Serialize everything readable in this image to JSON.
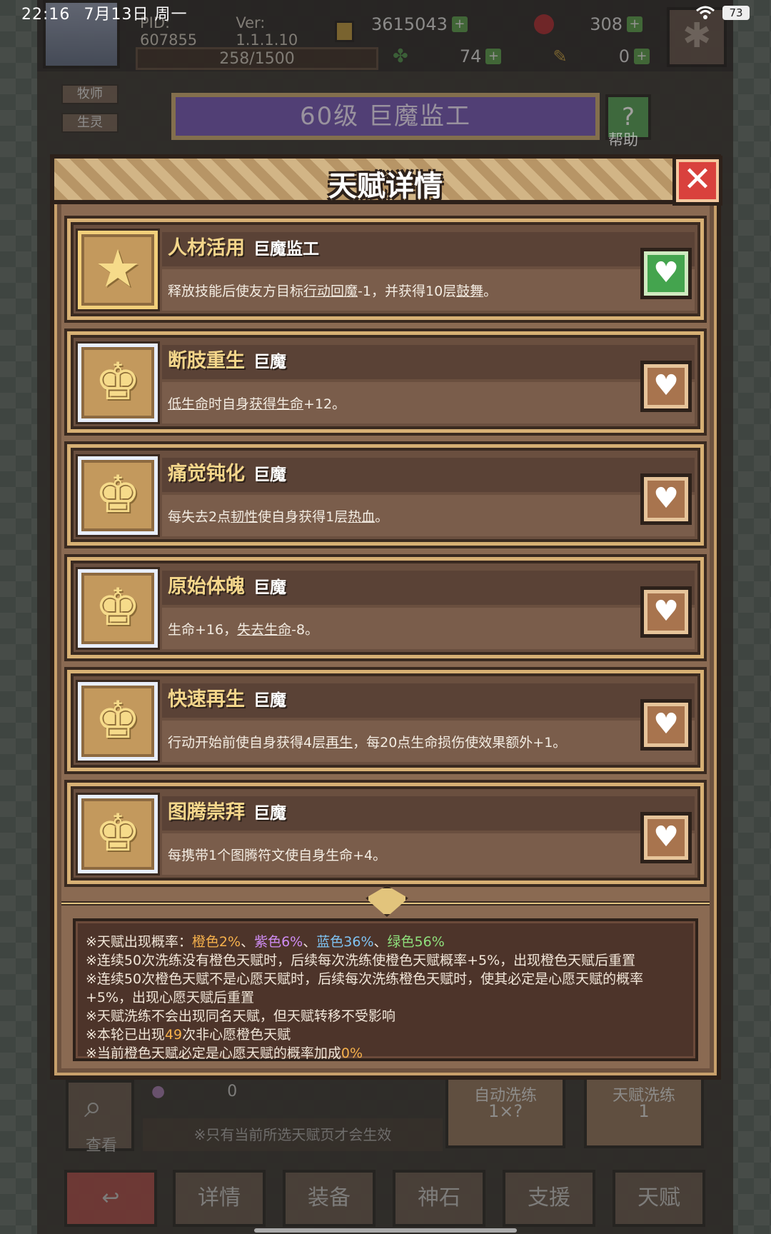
{
  "status_bar": {
    "time": "22:16",
    "date": "7月13日 周一",
    "battery": "73"
  },
  "header": {
    "pid": "PID: 607855",
    "version": "Ver: 1.1.1.10",
    "gold": "3615043",
    "gems": "308",
    "exp": "258/1500",
    "clover": "74",
    "item": "0"
  },
  "hero": {
    "class_tags": [
      "牧师",
      "生灵"
    ],
    "title": "60级  巨魔监工",
    "help_label": "帮助"
  },
  "modal": {
    "title": "天赋详情",
    "close_symbol": "✕",
    "talents": [
      {
        "name": "人材活用",
        "race": "巨魔监工",
        "favorited": true,
        "desc_parts": [
          "释放技能后使友方目标",
          "行动回魔",
          "-1，并获得10层",
          "鼓舞",
          "。"
        ]
      },
      {
        "name": "断肢重生",
        "race": "巨魔",
        "favorited": false,
        "desc_parts": [
          "",
          "低生命",
          "时自身",
          "获得生命",
          "+12。"
        ]
      },
      {
        "name": "痛觉钝化",
        "race": "巨魔",
        "favorited": false,
        "desc_parts": [
          "每失去2点",
          "韧性",
          "使自身获得1层",
          "热血",
          "。"
        ]
      },
      {
        "name": "原始体魄",
        "race": "巨魔",
        "favorited": false,
        "desc_parts": [
          "生命+16，",
          "失去生命",
          "-8。",
          "",
          ""
        ]
      },
      {
        "name": "快速再生",
        "race": "巨魔",
        "favorited": false,
        "desc_parts": [
          "行动开始前使自身获得4层",
          "再生",
          "，每20点生命损伤使效果额外+1。",
          "",
          ""
        ]
      },
      {
        "name": "图腾崇拜",
        "race": "巨魔",
        "favorited": false,
        "desc_parts": [
          "每携带1个图腾符文使自身生命+4。",
          "",
          "",
          "",
          ""
        ]
      }
    ],
    "info": {
      "rate_prefix": "※天赋出现概率：",
      "orange": "橙色2%",
      "sep1": "、",
      "purple": "紫色6%",
      "sep2": "、",
      "blue": "蓝色36%",
      "sep3": "、",
      "green": "绿色56%",
      "line2": "※连续50次洗练没有橙色天赋时，后续每次洗练使橙色天赋概率+5%，出现橙色天赋后重置",
      "line3": "※连续50次橙色天赋不是心愿天赋时，后续每次洗练橙色天赋时，使其必定是心愿天赋的概率+5%，出现心愿天赋后重置",
      "line4": "※天赋洗练不会出现同名天赋，但天赋转移不受影响",
      "line5_pre": "※本轮已出现",
      "line5_num": "49",
      "line5_post": "次非心愿橙色天赋",
      "line6_pre": "※当前橙色天赋必定是心愿天赋的概率加成",
      "line6_num": "0%"
    }
  },
  "lower": {
    "search_label": "查看",
    "cost": "0",
    "effect_note": "※只有当前所选天赋页才会生效",
    "auto_refine_label": "自动洗练",
    "auto_refine_value": "1×?",
    "refine_label": "天赋洗练",
    "refine_value": "1"
  },
  "bottom_nav": [
    "详情",
    "装备",
    "神石",
    "支援",
    "天赋"
  ],
  "colors": {
    "orange": "#f6b14c",
    "purple": "#cf8cf3",
    "blue": "#7fc3f3",
    "green": "#8fe07c",
    "fav_on": "#44a44e"
  }
}
